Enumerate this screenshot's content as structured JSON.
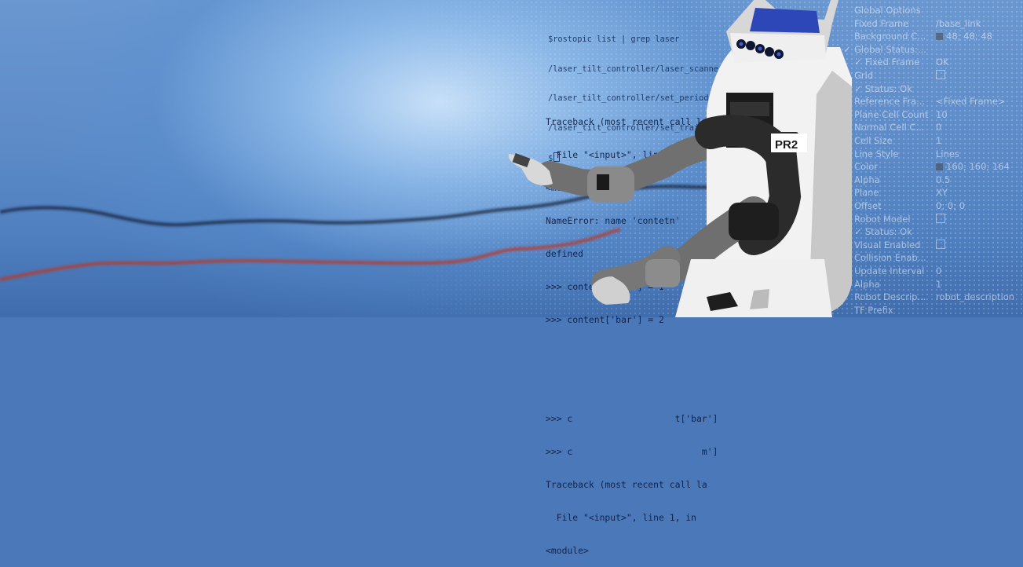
{
  "terminal_top": {
    "lines": [
      "$rostopic list | grep laser",
      "/laser_tilt_controller/laser_scanner_",
      "/laser_tilt_controller/set_periodic_c",
      "/laser_tilt_controller/set_traj_cmd",
      "$"
    ]
  },
  "terminal_main": {
    "lines": [
      "Traceback (most recent call last",
      "  File \"<input>\", line 1, in",
      "<module>",
      "NameError: name 'contetn'",
      "defined",
      ">>> content['foo'] = 1",
      ">>> content['bar'] = 2",
      "",
      "",
      "",
      ">>> c                   t['bar']",
      ">>> c                        m']",
      "Traceback (most recent call la",
      "  File \"<input>\", line 1, in",
      "<module>"
    ]
  },
  "rviz_panel": {
    "rows": [
      {
        "icon": "",
        "key": "Global Options",
        "value": ""
      },
      {
        "icon": "",
        "key": "Fixed Frame",
        "value": "/base_link"
      },
      {
        "icon": "",
        "key": "Background C...",
        "value": "48; 48; 48",
        "swatch": true
      },
      {
        "icon": "✓",
        "key": "Global Status:...",
        "value": ""
      },
      {
        "icon": "✓",
        "key": "Fixed Frame",
        "value": "OK",
        "indent": true
      },
      {
        "icon": "◈",
        "key": "Grid",
        "value": "",
        "checkbox": true
      },
      {
        "icon": "✓",
        "key": "Status: Ok",
        "value": "",
        "indent": true
      },
      {
        "icon": "",
        "key": "Reference Fra...",
        "value": "<Fixed Frame>"
      },
      {
        "icon": "",
        "key": "Plane Cell Count",
        "value": "10"
      },
      {
        "icon": "",
        "key": "Normal Cell C...",
        "value": "0"
      },
      {
        "icon": "",
        "key": "Cell Size",
        "value": "1"
      },
      {
        "icon": "",
        "key": "Line Style",
        "value": "Lines"
      },
      {
        "icon": "",
        "key": "Color",
        "value": "160; 160; 164",
        "swatch": true
      },
      {
        "icon": "",
        "key": "Alpha",
        "value": "0.5"
      },
      {
        "icon": "",
        "key": "Plane",
        "value": "XY"
      },
      {
        "icon": "",
        "key": "Offset",
        "value": "0; 0; 0"
      },
      {
        "icon": "",
        "key": "Robot Model",
        "value": "",
        "checkbox": true
      },
      {
        "icon": "✓",
        "key": "Status: Ok",
        "value": "",
        "indent": true
      },
      {
        "icon": "",
        "key": "Visual Enabled",
        "value": "",
        "checkbox": true
      },
      {
        "icon": "",
        "key": "Collision Enab...",
        "value": ""
      },
      {
        "icon": "",
        "key": "Update Interval",
        "value": "0"
      },
      {
        "icon": "",
        "key": "Alpha",
        "value": "1"
      },
      {
        "icon": "",
        "key": "Robot Descrip...",
        "value": "robot_description"
      },
      {
        "icon": "",
        "key": "TF Prefix",
        "value": ""
      }
    ]
  },
  "robot": {
    "badge": "PR2"
  },
  "colors": {
    "accent_blue": "#3a5fd0",
    "plot_dark": "#1b2740",
    "plot_red": "#b6382b"
  }
}
